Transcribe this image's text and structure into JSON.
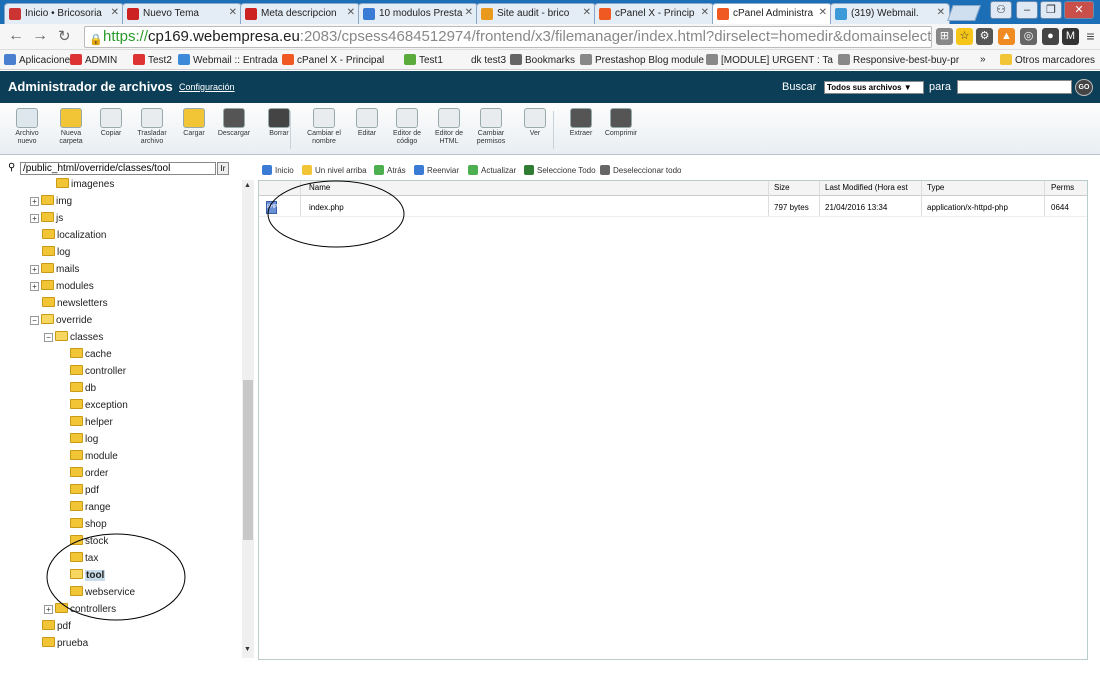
{
  "browser": {
    "tabs": [
      {
        "title": "Inicio • Bricosoria",
        "fav": "#c33",
        "active": false
      },
      {
        "title": "Nuevo Tema",
        "fav": "#c22",
        "active": false
      },
      {
        "title": "Meta descripcion",
        "fav": "#c22",
        "active": false
      },
      {
        "title": "10 modulos Presta",
        "fav": "#3a7bd5",
        "active": false
      },
      {
        "title": "Site audit - brico",
        "fav": "#e99a1c",
        "active": false
      },
      {
        "title": "cPanel X - Princip",
        "fav": "#f05a22",
        "active": false
      },
      {
        "title": "cPanel Administra",
        "fav": "#f05a22",
        "active": true
      },
      {
        "title": "(319) Webmail. ",
        "fav": "#3c9ad9",
        "active": false
      }
    ],
    "url_https": "https://",
    "url_host": "cp169.webempresa.eu",
    "url_path": ":2083/cpsess4684512974/frontend/x3/filemanager/index.html?dirselect=homedir&domainselect=",
    "bookmarks": [
      {
        "label": "Aplicaciones",
        "color": "#4a7fd0"
      },
      {
        "label": "ADMIN",
        "color": "#d33"
      },
      {
        "label": "Test2",
        "color": "#d33"
      },
      {
        "label": "Webmail :: Entrada",
        "color": "#3c8ad9"
      },
      {
        "label": "cPanel X - Principal",
        "color": "#f05a22"
      },
      {
        "label": "Test1",
        "color": "#5aaa3c"
      },
      {
        "label": "dk test3",
        "color": "transparent"
      },
      {
        "label": "Bookmarks",
        "color": "#666"
      },
      {
        "label": "Prestashop Blog module",
        "color": "#888"
      },
      {
        "label": "[MODULE] URGENT : Ta",
        "color": "#888"
      },
      {
        "label": "Responsive-best-buy-pr",
        "color": "#888"
      }
    ],
    "bookmarks_more": "»",
    "other_bookmarks": "Otros marcadores"
  },
  "cpanel": {
    "title": "Administrador de archivos",
    "config_link": "Configuración",
    "search_label": "Buscar",
    "search_select": "Todos sus archivos ▼",
    "search_para": "para",
    "go_label": "GO"
  },
  "toolbar": [
    {
      "label": "Archivo nuevo",
      "color": "#dfe7ee",
      "name": "new-file"
    },
    {
      "label": "Nueva carpeta",
      "color": "#f2c536",
      "name": "new-folder"
    },
    {
      "label": "Copiar",
      "color": "#e9ecef",
      "name": "copy"
    },
    {
      "label": "Trasladar archivo",
      "color": "#e9ecef",
      "name": "move"
    },
    {
      "label": "Cargar",
      "color": "#f2c536",
      "name": "upload"
    },
    {
      "label": "Descargar",
      "color": "#555",
      "name": "download"
    },
    {
      "label": "Borrar",
      "color": "#444",
      "name": "delete"
    },
    {
      "label": "Cambiar el nombre",
      "color": "#e9ecef",
      "name": "rename"
    },
    {
      "label": "Editar",
      "color": "#e9ecef",
      "name": "edit"
    },
    {
      "label": "Editor de código",
      "color": "#e9ecef",
      "name": "code-editor"
    },
    {
      "label": "Editor de HTML",
      "color": "#e9ecef",
      "name": "html-editor"
    },
    {
      "label": "Cambiar permisos",
      "color": "#e9ecef",
      "name": "permissions"
    },
    {
      "label": "Ver",
      "color": "#e9ecef",
      "name": "view"
    },
    {
      "label": "Extraer",
      "color": "#555",
      "name": "extract"
    },
    {
      "label": "Comprimir",
      "color": "#555",
      "name": "compress"
    }
  ],
  "tree": {
    "path_value": "/public_html/override/classes/tool",
    "path_go": "Ir",
    "nodes": [
      {
        "label": "imagenes",
        "level": 1,
        "pm": "",
        "open": false,
        "selected": false
      },
      {
        "label": "img",
        "level": 0,
        "pm": "+",
        "open": false,
        "selected": false
      },
      {
        "label": "js",
        "level": 0,
        "pm": "+",
        "open": false,
        "selected": false
      },
      {
        "label": "localization",
        "level": 0,
        "pm": "",
        "open": false,
        "selected": false
      },
      {
        "label": "log",
        "level": 0,
        "pm": "",
        "open": false,
        "selected": false
      },
      {
        "label": "mails",
        "level": 0,
        "pm": "+",
        "open": false,
        "selected": false
      },
      {
        "label": "modules",
        "level": 0,
        "pm": "+",
        "open": false,
        "selected": false
      },
      {
        "label": "newsletters",
        "level": 0,
        "pm": "",
        "open": false,
        "selected": false
      },
      {
        "label": "override",
        "level": 0,
        "pm": "−",
        "open": true,
        "selected": false
      },
      {
        "label": "classes",
        "level": 1,
        "pm": "−",
        "open": true,
        "selected": false
      },
      {
        "label": "cache",
        "level": 2,
        "pm": "",
        "open": false,
        "selected": false
      },
      {
        "label": "controller",
        "level": 2,
        "pm": "",
        "open": false,
        "selected": false
      },
      {
        "label": "db",
        "level": 2,
        "pm": "",
        "open": false,
        "selected": false
      },
      {
        "label": "exception",
        "level": 2,
        "pm": "",
        "open": false,
        "selected": false
      },
      {
        "label": "helper",
        "level": 2,
        "pm": "",
        "open": false,
        "selected": false
      },
      {
        "label": "log",
        "level": 2,
        "pm": "",
        "open": false,
        "selected": false
      },
      {
        "label": "module",
        "level": 2,
        "pm": "",
        "open": false,
        "selected": false
      },
      {
        "label": "order",
        "level": 2,
        "pm": "",
        "open": false,
        "selected": false
      },
      {
        "label": "pdf",
        "level": 2,
        "pm": "",
        "open": false,
        "selected": false
      },
      {
        "label": "range",
        "level": 2,
        "pm": "",
        "open": false,
        "selected": false
      },
      {
        "label": "shop",
        "level": 2,
        "pm": "",
        "open": false,
        "selected": false
      },
      {
        "label": "stock",
        "level": 2,
        "pm": "",
        "open": false,
        "selected": false
      },
      {
        "label": "tax",
        "level": 2,
        "pm": "",
        "open": false,
        "selected": false
      },
      {
        "label": "tool",
        "level": 2,
        "pm": "",
        "open": true,
        "selected": true
      },
      {
        "label": "webservice",
        "level": 2,
        "pm": "",
        "open": false,
        "selected": false
      },
      {
        "label": "controllers",
        "level": 1,
        "pm": "+",
        "open": false,
        "selected": false
      },
      {
        "label": "pdf",
        "level": 0,
        "pm": "",
        "open": false,
        "selected": false
      },
      {
        "label": "prueba",
        "level": 0,
        "pm": "",
        "open": false,
        "selected": false
      }
    ]
  },
  "navbar": [
    {
      "label": "Inicio",
      "color": "#3a7bd5"
    },
    {
      "label": "Un nivel arriba",
      "color": "#f2c536"
    },
    {
      "label": "Atrás",
      "color": "#4caf50"
    },
    {
      "label": "Reenviar",
      "color": "#3a7bd5"
    },
    {
      "label": "Actualizar",
      "color": "#4caf50"
    },
    {
      "label": "Seleccione Todo",
      "color": "#2e7d32"
    },
    {
      "label": "Deseleccionar todo",
      "color": "#666"
    }
  ],
  "table": {
    "headers": [
      "Name",
      "Size",
      "Last Modified (Hora est",
      "Type",
      "Perms"
    ],
    "rows": [
      {
        "icon": "PHP",
        "name": "index.php",
        "size": "797 bytes",
        "modified": "21/04/2016 13:34",
        "type": "application/x-httpd-php",
        "perms": "0644"
      }
    ]
  }
}
